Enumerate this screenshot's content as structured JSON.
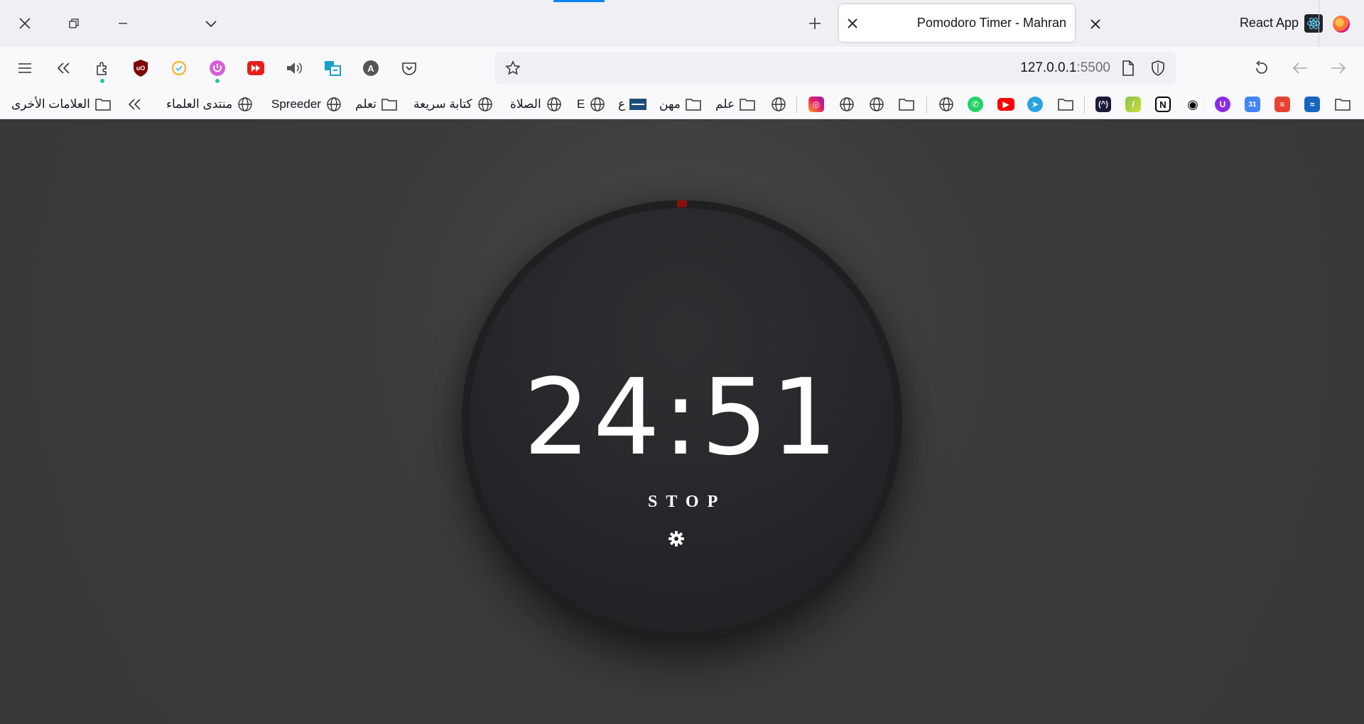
{
  "tabs": {
    "active": {
      "title": "Pomodoro Timer - Mahran"
    },
    "second": {
      "title": "React App"
    }
  },
  "urlbar": {
    "host": "127.0.0.1",
    "port": ":5500"
  },
  "bookmarks": {
    "other": "العلامات الأخرى",
    "items": [
      {
        "label": "منتدى العلماء"
      },
      {
        "label": "Spreeder"
      },
      {
        "label": "تعلم"
      },
      {
        "label": "كتابة سريعة"
      },
      {
        "label": "الصلاة"
      },
      {
        "label": "E"
      },
      {
        "label": "ع"
      },
      {
        "label": "مهن"
      },
      {
        "label": "علم"
      }
    ]
  },
  "timer": {
    "time": "24:51",
    "action_label": "STOP"
  },
  "colors": {
    "page_bg": "#3a3a3a",
    "timer_bg": "#1f1f21",
    "progress": "#8a1010",
    "accent": "#0a84ff"
  }
}
